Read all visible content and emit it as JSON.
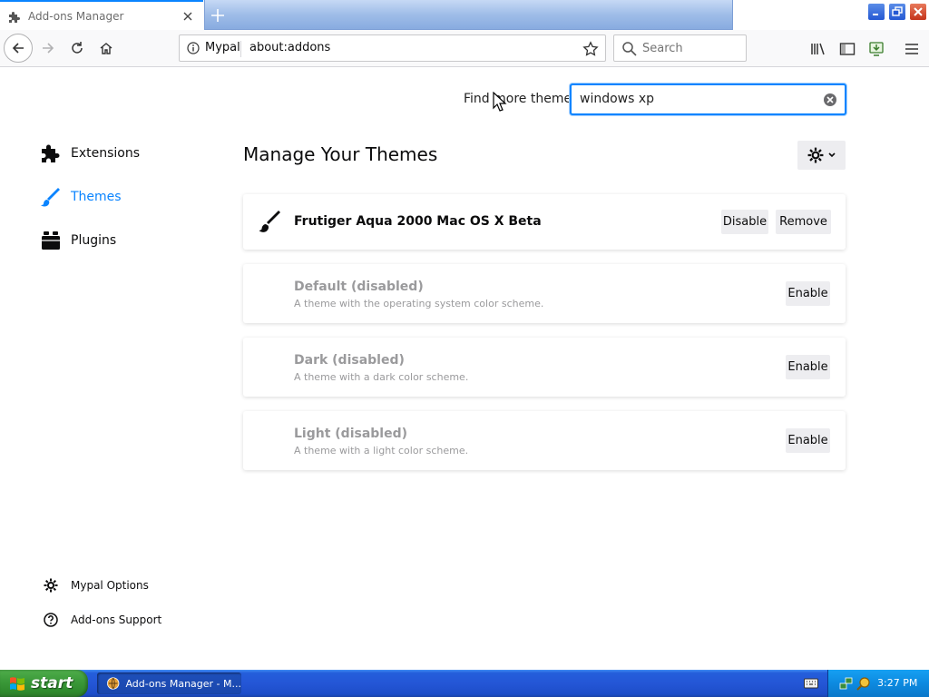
{
  "browser": {
    "tab": {
      "title": "Add-ons Manager"
    },
    "urlbar": {
      "site_name": "Mypal",
      "url": "about:addons"
    },
    "searchbar": {
      "placeholder": "Search"
    }
  },
  "addons_page": {
    "find_more_label": "Find more themes",
    "find_input_value": "windows xp",
    "heading": "Manage Your Themes",
    "categories": [
      {
        "label": "Extensions",
        "icon": "puzzle-icon"
      },
      {
        "label": "Themes",
        "icon": "brush-icon",
        "selected": true
      },
      {
        "label": "Plugins",
        "icon": "plugin-icon"
      }
    ],
    "footer_links": [
      {
        "label": "Mypal Options",
        "icon": "gear-icon"
      },
      {
        "label": "Add-ons Support",
        "icon": "help-icon"
      }
    ],
    "themes": [
      {
        "name": "Frutiger Aqua 2000 Mac OS X Beta",
        "description": "",
        "enabled": true,
        "buttons": [
          "Disable",
          "Remove"
        ]
      },
      {
        "name": "Default (disabled)",
        "description": "A theme with the operating system color scheme.",
        "enabled": false,
        "buttons": [
          "Enable"
        ]
      },
      {
        "name": "Dark (disabled)",
        "description": "A theme with a dark color scheme.",
        "enabled": false,
        "buttons": [
          "Enable"
        ]
      },
      {
        "name": "Light (disabled)",
        "description": "A theme with a light color scheme.",
        "enabled": false,
        "buttons": [
          "Enable"
        ]
      }
    ]
  },
  "taskbar": {
    "start_label": "start",
    "task_label": "Add-ons Manager - M...",
    "clock": "3:27 PM"
  },
  "colors": {
    "accent": "#0a84ff",
    "taskbar": "#245edb",
    "start_green": "#3c9a3a"
  }
}
